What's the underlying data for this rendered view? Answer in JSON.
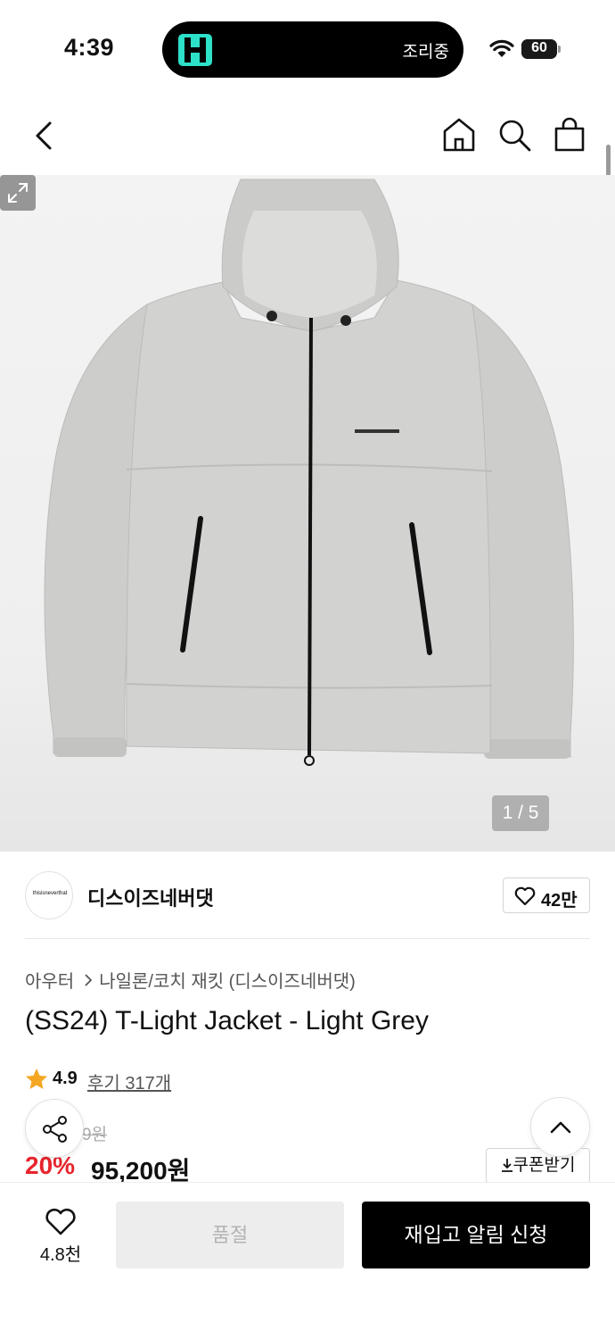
{
  "status_bar": {
    "time": "4:39",
    "island_text": "조리중",
    "battery": "60",
    "battery_level": 0.6
  },
  "nav": {
    "back_icon": "chevron-left-icon",
    "home_icon": "home-icon",
    "search_icon": "search-icon",
    "bag_icon": "shopping-bag-icon"
  },
  "gallery": {
    "counter": "1 / 5",
    "image_logo": "thisisneverthat"
  },
  "brand": {
    "logo_text": "thisisneverthat",
    "name": "디스이즈네버댓",
    "likes": "42만"
  },
  "product": {
    "breadcrumb": [
      "아우터",
      "나일론/코치 재킷 (디스이즈네버댓)"
    ],
    "title": "(SS24) T-Light Jacket - Light Grey",
    "rating": "4.9",
    "reviews": "후기 317개",
    "original_price_visible": "9원",
    "discount": "20%",
    "price": "95,200원",
    "coupon_label": "쿠폰받기"
  },
  "bottom_bar": {
    "wish_count": "4.8천",
    "soldout_label": "품절",
    "restock_label": "재입고 알림 신청"
  },
  "colors": {
    "accent_red": "#e7252d",
    "island_logo": "#2de0c8",
    "star": "#f5a623"
  }
}
